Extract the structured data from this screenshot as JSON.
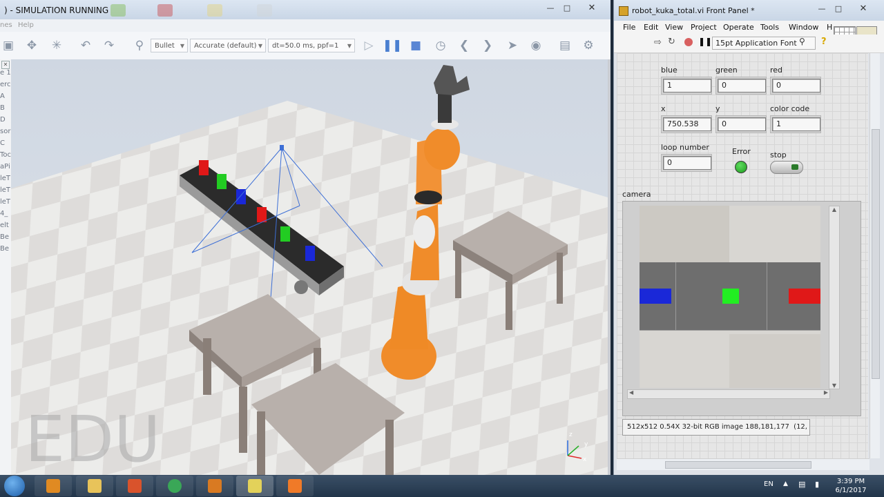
{
  "sim": {
    "title": ") - SIMULATION RUNNING",
    "menu_left": "nes",
    "menu_help": "Help",
    "physics_engine": "Bullet",
    "accuracy": "Accurate (default)",
    "dt": "dt=50.0 ms, ppf=1",
    "sidebar_items": [
      "e 1",
      "erc",
      "A",
      "B",
      "D",
      "sor",
      "C",
      "Toc",
      "aPi",
      "leT",
      "leT",
      "leT",
      "4_",
      "elt",
      "Be",
      "Be"
    ],
    "watermark": "EDU",
    "axes": {
      "x": "x",
      "y": "y",
      "z": "z"
    }
  },
  "labview": {
    "title": "robot_kuka_total.vi Front Panel *",
    "menu": [
      "File",
      "Edit",
      "View",
      "Project",
      "Operate",
      "Tools",
      "Window",
      "H"
    ],
    "font_selector": "15pt Application Font",
    "controls": {
      "blue": {
        "label": "blue",
        "value": "1"
      },
      "green": {
        "label": "green",
        "value": "0"
      },
      "red": {
        "label": "red",
        "value": "0"
      },
      "x": {
        "label": "x",
        "value": "750.538"
      },
      "y": {
        "label": "y",
        "value": "0"
      },
      "color_code": {
        "label": "color code",
        "value": "1"
      },
      "loop_number": {
        "label": "loop number",
        "value": "0"
      },
      "error": {
        "label": "Error"
      },
      "stop": {
        "label": "stop"
      }
    },
    "camera_label": "camera",
    "image_info": "512x512 0.54X 32-bit RGB image 188,181,177",
    "image_coord": "(12,"
  },
  "taskbar": {
    "language": "EN",
    "time": "3:39 PM",
    "date": "6/1/2017"
  },
  "colors": {
    "robot_orange": "#f08c2a",
    "block_red": "#e01818",
    "block_green": "#22cc22",
    "block_blue": "#1a28d8",
    "error_led": "#1c9b1c"
  }
}
